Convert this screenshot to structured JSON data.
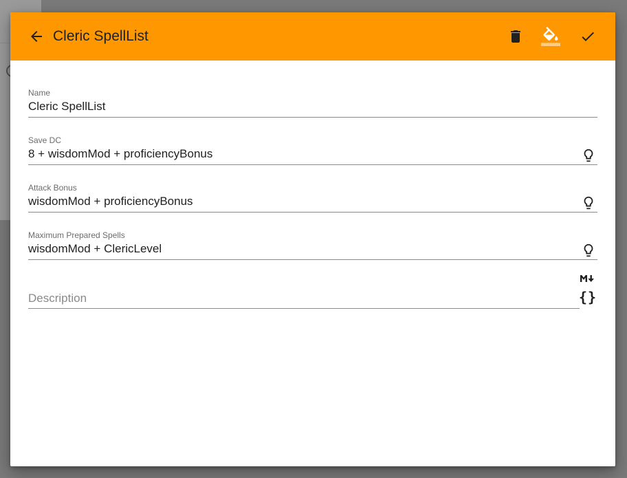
{
  "dialog": {
    "title": "Cleric SpellList",
    "accent_color": "#ff9800",
    "toolbar_icons": [
      "arrow-back-icon",
      "delete-icon",
      "format-color-fill-icon",
      "check-icon"
    ]
  },
  "fields": {
    "name": {
      "label": "Name",
      "value": "Cleric SpellList"
    },
    "save_dc": {
      "label": "Save DC",
      "value": "8 + wisdomMod + proficiencyBonus"
    },
    "attack_bonus": {
      "label": "Attack Bonus",
      "value": "wisdomMod + proficiencyBonus"
    },
    "max_prepared": {
      "label": "Maximum Prepared Spells",
      "value": "wisdomMod + ClericLevel"
    },
    "description": {
      "placeholder": "Description",
      "value": ""
    }
  },
  "description_tools": {
    "markdown_icon": "markdown-icon",
    "braces_label": "{}"
  }
}
